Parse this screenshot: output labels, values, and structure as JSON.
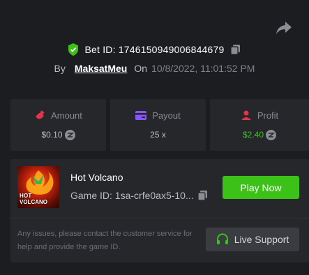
{
  "bet": {
    "id_label": "Bet ID: 1746150949006844679",
    "by_label": "By",
    "username": "MaksatMeu",
    "on_label": "On",
    "date": "10/8/2022, 11:01:52 PM"
  },
  "stats": {
    "amount": {
      "label": "Amount",
      "value": "$0.10",
      "icon": "bet-hand-icon",
      "color": "#e5334b"
    },
    "payout": {
      "label": "Payout",
      "value": "25 x",
      "icon": "wallet-card-icon",
      "color": "#8a54ff"
    },
    "profit": {
      "label": "Profit",
      "value": "$2.40",
      "icon": "profit-user-icon",
      "color": "#e5334b",
      "value_color": "#3bc117"
    }
  },
  "game": {
    "name": "Hot Volcano",
    "id_label": "Game ID: 1sa-crfe0ax5-10...",
    "thumb_line1": "HOT",
    "thumb_line2": "VOLCANO",
    "play_label": "Play Now"
  },
  "support": {
    "text": "Any issues, please contact the customer service for help and provide the game ID.",
    "button_label": "Live Support"
  },
  "colors": {
    "background": "#1c1d20",
    "card": "#26272b",
    "accent_green": "#3bc117",
    "shield_green": "#3bc117"
  }
}
